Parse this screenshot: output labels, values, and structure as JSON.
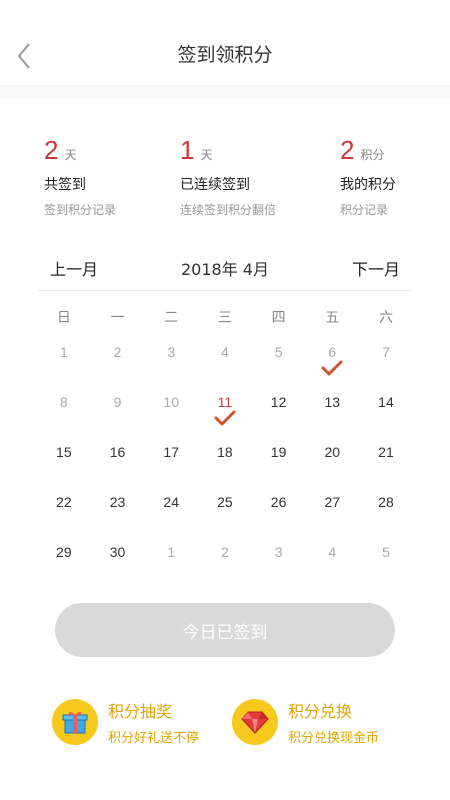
{
  "header": {
    "title": "签到领积分",
    "back_icon": "chevron-left-icon"
  },
  "stats": [
    {
      "value": "2",
      "unit": "天",
      "label": "共签到",
      "sub": "签到积分记录"
    },
    {
      "value": "1",
      "unit": "天",
      "label": "已连续签到",
      "sub": "连续签到积分翻倍"
    },
    {
      "value": "2",
      "unit": "积分",
      "label": "我的积分",
      "sub": "积分记录"
    }
  ],
  "calendar": {
    "prev_label": "上一月",
    "next_label": "下一月",
    "year_month": "2018年 4月",
    "weekdays": [
      "日",
      "一",
      "二",
      "三",
      "四",
      "五",
      "六"
    ],
    "weeks": [
      [
        {
          "d": "1",
          "muted": true
        },
        {
          "d": "2",
          "muted": true
        },
        {
          "d": "3",
          "muted": true
        },
        {
          "d": "4",
          "muted": true
        },
        {
          "d": "5",
          "muted": true
        },
        {
          "d": "6",
          "muted": true,
          "checked": true
        },
        {
          "d": "7",
          "muted": true
        }
      ],
      [
        {
          "d": "8",
          "muted": true
        },
        {
          "d": "9",
          "muted": true
        },
        {
          "d": "10",
          "muted": true
        },
        {
          "d": "11",
          "today": true,
          "checked": true
        },
        {
          "d": "12"
        },
        {
          "d": "13"
        },
        {
          "d": "14"
        }
      ],
      [
        {
          "d": "15"
        },
        {
          "d": "16"
        },
        {
          "d": "17"
        },
        {
          "d": "18"
        },
        {
          "d": "19"
        },
        {
          "d": "20"
        },
        {
          "d": "21"
        }
      ],
      [
        {
          "d": "22"
        },
        {
          "d": "23"
        },
        {
          "d": "24"
        },
        {
          "d": "25"
        },
        {
          "d": "26"
        },
        {
          "d": "27"
        },
        {
          "d": "28"
        }
      ],
      [
        {
          "d": "29"
        },
        {
          "d": "30"
        },
        {
          "d": "1",
          "muted": true
        },
        {
          "d": "2",
          "muted": true
        },
        {
          "d": "3",
          "muted": true
        },
        {
          "d": "4",
          "muted": true
        },
        {
          "d": "5",
          "muted": true
        }
      ]
    ]
  },
  "sign_button": {
    "label": "今日已签到"
  },
  "features": [
    {
      "title": "积分抽奖",
      "subtitle": "积分好礼送不停",
      "icon": "gift-icon"
    },
    {
      "title": "积分兑换",
      "subtitle": "积分兑换现金币",
      "icon": "gem-icon"
    }
  ],
  "colors": {
    "accent_red": "#c83a3a",
    "check_orange": "#d2542a",
    "gold": "#f7c81e",
    "gold_text": "#e0a500",
    "button_disabled": "#d9d9d9"
  }
}
